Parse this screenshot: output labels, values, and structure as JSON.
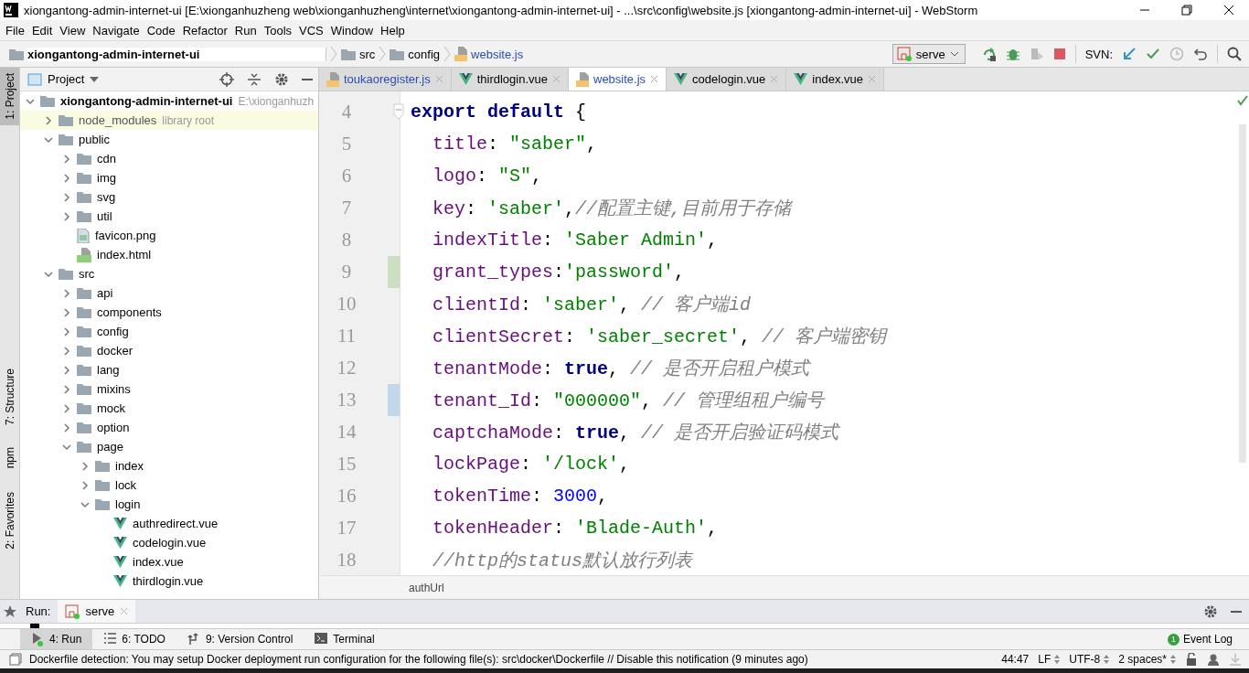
{
  "window": {
    "title": "xiongantong-admin-internet-ui [E:\\xionganhuzheng web\\xionganhuzheng\\internet\\xiongantong-admin-internet-ui] - ...\\src\\config\\website.js [xiongantong-admin-internet-ui] - WebStorm"
  },
  "menu": [
    "File",
    "Edit",
    "View",
    "Navigate",
    "Code",
    "Refactor",
    "Run",
    "Tools",
    "VCS",
    "Window",
    "Help"
  ],
  "breadcrumbs": [
    {
      "label": "xiongantong-admin-internet-ui",
      "kind": "project"
    },
    {
      "label": "src",
      "kind": "folder"
    },
    {
      "label": "config",
      "kind": "folder"
    },
    {
      "label": "website.js",
      "kind": "js"
    }
  ],
  "toolbar": {
    "run_config": "serve",
    "svn_label": "SVN:"
  },
  "side_stripe": [
    {
      "label": "1: Project",
      "selected": true
    },
    {
      "label": "7: Structure",
      "selected": false
    },
    {
      "label": "npm",
      "selected": false
    },
    {
      "label": "2: Favorites",
      "selected": false
    }
  ],
  "project_panel": {
    "title": "Project",
    "tree": [
      {
        "label": "xiongantong-admin-internet-ui",
        "kind": "root",
        "hint": "E:\\xionganhuzh",
        "expanded": true,
        "children": [
          {
            "label": "node_modules",
            "kind": "library",
            "hint": "library root",
            "expanded": false
          },
          {
            "label": "public",
            "kind": "folder",
            "expanded": true,
            "children": [
              {
                "label": "cdn",
                "kind": "folder",
                "expanded": false
              },
              {
                "label": "img",
                "kind": "folder",
                "expanded": false
              },
              {
                "label": "svg",
                "kind": "folder",
                "expanded": false
              },
              {
                "label": "util",
                "kind": "folder",
                "expanded": false
              },
              {
                "label": "favicon.png",
                "kind": "image"
              },
              {
                "label": "index.html",
                "kind": "html"
              }
            ]
          },
          {
            "label": "src",
            "kind": "folder",
            "expanded": true,
            "children": [
              {
                "label": "api",
                "kind": "folder",
                "expanded": false
              },
              {
                "label": "components",
                "kind": "folder",
                "expanded": false
              },
              {
                "label": "config",
                "kind": "folder",
                "expanded": false
              },
              {
                "label": "docker",
                "kind": "folder",
                "expanded": false
              },
              {
                "label": "lang",
                "kind": "folder",
                "expanded": false
              },
              {
                "label": "mixins",
                "kind": "folder",
                "expanded": false
              },
              {
                "label": "mock",
                "kind": "folder",
                "expanded": false
              },
              {
                "label": "option",
                "kind": "folder",
                "expanded": false
              },
              {
                "label": "page",
                "kind": "folder",
                "expanded": true,
                "children": [
                  {
                    "label": "index",
                    "kind": "folder",
                    "expanded": false
                  },
                  {
                    "label": "lock",
                    "kind": "folder",
                    "expanded": false
                  },
                  {
                    "label": "login",
                    "kind": "folder",
                    "expanded": true,
                    "children": [
                      {
                        "label": "authredirect.vue",
                        "kind": "vue"
                      },
                      {
                        "label": "codelogin.vue",
                        "kind": "vue"
                      },
                      {
                        "label": "index.vue",
                        "kind": "vue"
                      },
                      {
                        "label": "thirdlogin.vue",
                        "kind": "vue"
                      }
                    ]
                  }
                ]
              }
            ]
          }
        ]
      }
    ]
  },
  "editor_tabs": [
    {
      "label": "toukaoregister.js",
      "kind": "js",
      "modified": true,
      "selected": false
    },
    {
      "label": "thirdlogin.vue",
      "kind": "vue",
      "modified": false,
      "selected": false
    },
    {
      "label": "website.js",
      "kind": "js",
      "modified": true,
      "selected": true
    },
    {
      "label": "codelogin.vue",
      "kind": "vue",
      "modified": false,
      "selected": false
    },
    {
      "label": "index.vue",
      "kind": "vue",
      "modified": false,
      "selected": false
    }
  ],
  "code_lines": [
    {
      "number": "4",
      "indented": false,
      "added": false,
      "modified": false,
      "tokens": [
        {
          "kind": "keyword",
          "text": "export default"
        },
        {
          "kind": "punct",
          "text": " {"
        }
      ]
    },
    {
      "number": "5",
      "indented": true,
      "added": false,
      "modified": false,
      "tokens": [
        {
          "kind": "prop",
          "text": "title"
        },
        {
          "kind": "punct",
          "text": ": "
        },
        {
          "kind": "string",
          "text": "\"saber\""
        },
        {
          "kind": "punct",
          "text": ","
        }
      ]
    },
    {
      "number": "6",
      "indented": true,
      "added": false,
      "modified": false,
      "tokens": [
        {
          "kind": "prop",
          "text": "logo"
        },
        {
          "kind": "punct",
          "text": ": "
        },
        {
          "kind": "string",
          "text": "\"S\""
        },
        {
          "kind": "punct",
          "text": ","
        }
      ]
    },
    {
      "number": "7",
      "indented": true,
      "added": false,
      "modified": false,
      "tokens": [
        {
          "kind": "prop",
          "text": "key"
        },
        {
          "kind": "punct",
          "text": ": "
        },
        {
          "kind": "string",
          "text": "'saber'"
        },
        {
          "kind": "punct",
          "text": ","
        },
        {
          "kind": "comment",
          "text": "//配置主键,目前用于存储"
        }
      ]
    },
    {
      "number": "8",
      "indented": true,
      "added": false,
      "modified": false,
      "tokens": [
        {
          "kind": "prop",
          "text": "indexTitle"
        },
        {
          "kind": "punct",
          "text": ": "
        },
        {
          "kind": "string",
          "text": "'Saber Admin'"
        },
        {
          "kind": "punct",
          "text": ","
        }
      ]
    },
    {
      "number": "9",
      "indented": true,
      "added": true,
      "modified": false,
      "tokens": [
        {
          "kind": "prop",
          "text": "grant_types"
        },
        {
          "kind": "punct",
          "text": ":"
        },
        {
          "kind": "string",
          "text": "'password'"
        },
        {
          "kind": "punct",
          "text": ","
        }
      ]
    },
    {
      "number": "10",
      "indented": true,
      "added": false,
      "modified": false,
      "tokens": [
        {
          "kind": "prop",
          "text": "clientId"
        },
        {
          "kind": "punct",
          "text": ": "
        },
        {
          "kind": "string",
          "text": "'saber'"
        },
        {
          "kind": "punct",
          "text": ", "
        },
        {
          "kind": "comment",
          "text": "// 客户端id"
        }
      ]
    },
    {
      "number": "11",
      "indented": true,
      "added": false,
      "modified": false,
      "tokens": [
        {
          "kind": "prop",
          "text": "clientSecret"
        },
        {
          "kind": "punct",
          "text": ": "
        },
        {
          "kind": "string",
          "text": "'saber_secret'"
        },
        {
          "kind": "punct",
          "text": ", "
        },
        {
          "kind": "comment",
          "text": "// 客户端密钥"
        }
      ]
    },
    {
      "number": "12",
      "indented": true,
      "added": false,
      "modified": false,
      "tokens": [
        {
          "kind": "prop",
          "text": "tenantMode"
        },
        {
          "kind": "punct",
          "text": ": "
        },
        {
          "kind": "keyword",
          "text": "true"
        },
        {
          "kind": "punct",
          "text": ", "
        },
        {
          "kind": "comment",
          "text": "// 是否开启租户模式"
        }
      ]
    },
    {
      "number": "13",
      "indented": true,
      "added": false,
      "modified": true,
      "tokens": [
        {
          "kind": "prop",
          "text": "tenant_Id"
        },
        {
          "kind": "punct",
          "text": ": "
        },
        {
          "kind": "string",
          "text": "\"000000\""
        },
        {
          "kind": "punct",
          "text": ", "
        },
        {
          "kind": "comment",
          "text": "// 管理组租户编号"
        }
      ]
    },
    {
      "number": "14",
      "indented": true,
      "added": false,
      "modified": false,
      "tokens": [
        {
          "kind": "prop",
          "text": "captchaMode"
        },
        {
          "kind": "punct",
          "text": ": "
        },
        {
          "kind": "keyword",
          "text": "true"
        },
        {
          "kind": "punct",
          "text": ", "
        },
        {
          "kind": "comment",
          "text": "// 是否开启验证码模式"
        }
      ]
    },
    {
      "number": "15",
      "indented": true,
      "added": false,
      "modified": false,
      "tokens": [
        {
          "kind": "prop",
          "text": "lockPage"
        },
        {
          "kind": "punct",
          "text": ": "
        },
        {
          "kind": "string",
          "text": "'/lock'"
        },
        {
          "kind": "punct",
          "text": ","
        }
      ]
    },
    {
      "number": "16",
      "indented": true,
      "added": false,
      "modified": false,
      "tokens": [
        {
          "kind": "prop",
          "text": "tokenTime"
        },
        {
          "kind": "punct",
          "text": ": "
        },
        {
          "kind": "number",
          "text": "3000"
        },
        {
          "kind": "punct",
          "text": ","
        }
      ]
    },
    {
      "number": "17",
      "indented": true,
      "added": false,
      "modified": false,
      "tokens": [
        {
          "kind": "prop",
          "text": "tokenHeader"
        },
        {
          "kind": "punct",
          "text": ": "
        },
        {
          "kind": "string",
          "text": "'Blade-Auth'"
        },
        {
          "kind": "punct",
          "text": ","
        }
      ]
    },
    {
      "number": "18",
      "indented": true,
      "added": false,
      "modified": false,
      "tokens": [
        {
          "kind": "comment",
          "text": "//http的status默认放行列表"
        }
      ]
    }
  ],
  "editor_breadcrumb": "authUrl",
  "run_panel": {
    "label": "Run:",
    "tabs": [
      {
        "label": "serve",
        "selected": true
      }
    ]
  },
  "tool_tabs": [
    {
      "label": "4: Run",
      "kind": "run",
      "selected": true
    },
    {
      "label": "6: TODO",
      "kind": "todo",
      "selected": false
    },
    {
      "label": "9: Version Control",
      "kind": "vcs",
      "selected": false
    },
    {
      "label": "Terminal",
      "kind": "terminal",
      "selected": false
    }
  ],
  "event_log": {
    "label": "Event Log",
    "count": "1"
  },
  "status_bar": {
    "message": "Dockerfile detection: You may setup Docker deployment run configuration for the following file(s): src\\docker\\Dockerfile // Disable this notification (9 minutes ago)",
    "position": "44:47",
    "line_separator": "LF",
    "encoding": "UTF-8",
    "indent": "2 spaces*"
  }
}
